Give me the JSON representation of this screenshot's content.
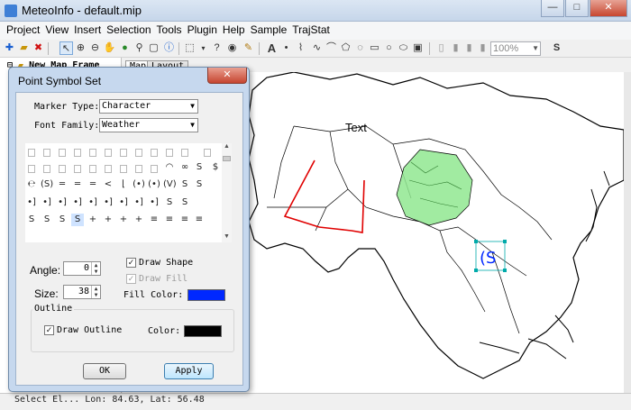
{
  "window": {
    "title": "MeteoInfo - default.mip",
    "min": "—",
    "max": "□",
    "close": "✕"
  },
  "menu": [
    "Project",
    "View",
    "Insert",
    "Selection",
    "Tools",
    "Plugin",
    "Help",
    "Sample",
    "TrajStat"
  ],
  "toolbar": {
    "zoom_value": "100%"
  },
  "legend": {
    "item": "New Map Frame"
  },
  "tabs": [
    {
      "label": "Map"
    },
    {
      "label": "Layout"
    }
  ],
  "map": {
    "text_label": "Text"
  },
  "status": {
    "text": "Select El...   Lon: 84.63, Lat: 56.48"
  },
  "dialog": {
    "title": "Point Symbol Set",
    "close": "✕",
    "marker_type_label": "Marker Type:",
    "marker_type_value": "Character",
    "font_family_label": "Font Family:",
    "font_family_value": "Weather",
    "angle_label": "Angle:",
    "angle_value": "0",
    "size_label": "Size:",
    "size_value": "38",
    "draw_shape_label": "Draw Shape",
    "draw_fill_label": "Draw Fill",
    "fill_color_label": "Fill Color:",
    "outline_group": "Outline",
    "draw_outline_label": "Draw Outline",
    "color_label": "Color:",
    "ok": "OK",
    "apply": "Apply"
  },
  "symbols": {
    "row2": [
      "℮",
      "(S)",
      "═",
      "═",
      "═",
      "<",
      "⌊",
      "(•)",
      "(•)",
      "(V)",
      "S",
      "S"
    ],
    "row3": [
      "•]",
      "•]",
      "•]",
      "•]",
      "•]",
      "•]",
      "•]",
      "•]",
      "•]",
      "S",
      "S",
      ""
    ],
    "row4": [
      "S",
      "S",
      "S",
      "S",
      "+",
      "+",
      "+",
      "+",
      "≡",
      "≡",
      "≡",
      "≡"
    ]
  },
  "colors": {
    "fill": "#0028ff",
    "outline": "#000000",
    "province": "#90e890",
    "track": "#e00000",
    "selection": "#00aaaa"
  }
}
